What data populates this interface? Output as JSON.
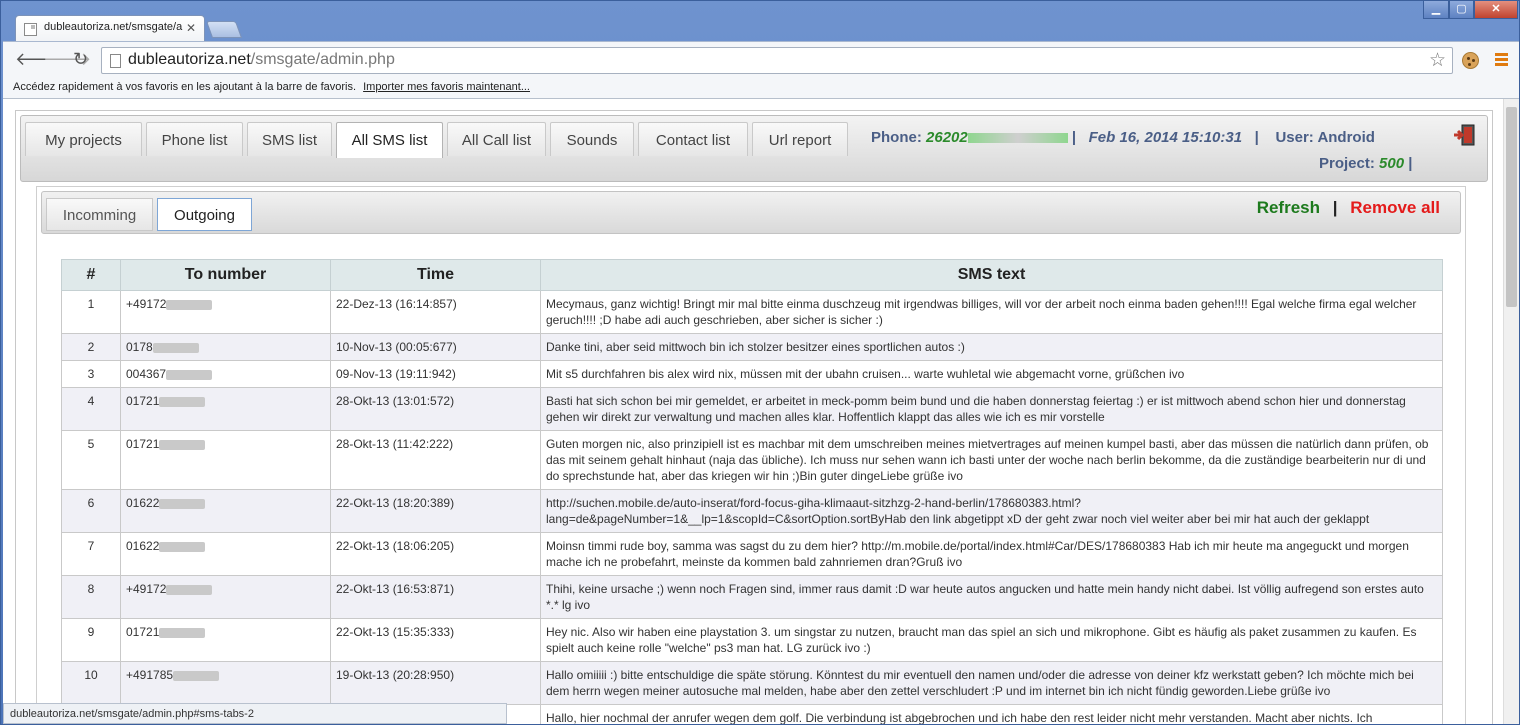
{
  "browser": {
    "tab_title": "dubleautoriza.net/smsgate/a",
    "url_domain": "dubleautoriza.net",
    "url_path": "/smsgate/admin.php",
    "bookmarks_text": "Accédez rapidement à vos favoris en les ajoutant à la barre de favoris.",
    "bookmarks_link": "Importer mes favoris maintenant...",
    "status_url": "dubleautoriza.net/smsgate/admin.php#sms-tabs-2"
  },
  "nav": {
    "tabs": [
      "My projects",
      "Phone list",
      "SMS list",
      "All SMS list",
      "All Call list",
      "Sounds",
      "Contact list",
      "Url report"
    ],
    "active": "All SMS list"
  },
  "header": {
    "phone_label": "Phone:",
    "phone_value": "26202",
    "date": "Feb 16, 2014 15:10:31",
    "user_label": "User:",
    "user_value": "Android",
    "project_label": "Project:",
    "project_value": "500",
    "separator": "|"
  },
  "subnav": {
    "tabs": [
      "Incomming",
      "Outgoing"
    ],
    "active": "Outgoing",
    "refresh": "Refresh",
    "separator": "|",
    "remove_all": "Remove all"
  },
  "table": {
    "headers": [
      "#",
      "To number",
      "Time",
      "SMS text"
    ],
    "rows": [
      {
        "n": "1",
        "to": "+49172",
        "time": "22-Dez-13 (16:14:857)",
        "text": "Mecymaus, ganz wichtig! Bringt mir mal bitte einma duschzeug mit irgendwas billiges, will vor der arbeit noch einma baden gehen!!!! Egal welche firma egal welcher geruch!!!! ;D habe adi auch geschrieben, aber sicher is sicher :)"
      },
      {
        "n": "2",
        "to": "0178",
        "time": "10-Nov-13 (00:05:677)",
        "text": "Danke tini, aber seid mittwoch bin ich stolzer besitzer eines sportlichen autos :)"
      },
      {
        "n": "3",
        "to": "004367",
        "time": "09-Nov-13 (19:11:942)",
        "text": "Mit s5 durchfahren bis alex wird nix, müssen mit der ubahn cruisen... warte wuhletal wie abgemacht vorne, grüßchen ivo"
      },
      {
        "n": "4",
        "to": "01721",
        "time": "28-Okt-13 (13:01:572)",
        "text": "Basti hat sich schon bei mir gemeldet, er arbeitet in meck-pomm beim bund und die haben donnerstag feiertag :) er ist mittwoch abend schon hier und donnerstag gehen wir direkt zur verwaltung und machen alles klar. Hoffentlich klappt das alles wie ich es mir vorstelle"
      },
      {
        "n": "5",
        "to": "01721",
        "time": "28-Okt-13 (11:42:222)",
        "text": "Guten morgen nic, also prinzipiell ist es machbar mit dem umschreiben meines mietvertrages auf meinen kumpel basti, aber das müssen die natürlich dann prüfen, ob das mit seinem gehalt hinhaut (naja das übliche). Ich muss nur sehen wann ich basti unter der woche nach berlin bekomme, da die zuständige bearbeiterin nur di und do sprechstunde hat, aber das kriegen wir hin ;)Bin guter dingeLiebe grüße ivo"
      },
      {
        "n": "6",
        "to": "01622",
        "time": "22-Okt-13 (18:20:389)",
        "text": "http://suchen.mobile.de/auto-inserat/ford-focus-giha-klimaaut-sitzhzg-2-hand-berlin/178680383.html?lang=de&pageNumber=1&__lp=1&scopId=C&sortOption.sortByHab den link abgetippt xD der geht zwar noch viel weiter aber bei mir hat auch der geklappt"
      },
      {
        "n": "7",
        "to": "01622",
        "time": "22-Okt-13 (18:06:205)",
        "text": "Moinsn timmi rude boy, samma was sagst du zu dem hier? http://m.mobile.de/portal/index.html#Car/DES/178680383 Hab ich mir heute ma angeguckt und morgen mache ich ne probefahrt, meinste da kommen bald zahnriemen dran?Gruß ivo"
      },
      {
        "n": "8",
        "to": "+49172",
        "time": "22-Okt-13 (16:53:871)",
        "text": "Thihi, keine ursache ;) wenn noch Fragen sind, immer raus damit :D war heute autos angucken und hatte mein handy nicht dabei. Ist völlig aufregend son erstes auto *.* lg ivo"
      },
      {
        "n": "9",
        "to": "01721",
        "time": "22-Okt-13 (15:35:333)",
        "text": "Hey nic. Also wir haben eine playstation 3. um singstar zu nutzen, braucht man das spiel an sich und mikrophone. Gibt es häufig als paket zusammen zu kaufen. Es spielt auch keine rolle \"welche\" ps3 man hat. LG zurück ivo :)"
      },
      {
        "n": "10",
        "to": "+491785",
        "time": "19-Okt-13 (20:28:950)",
        "text": "Hallo omiiiii :) bitte entschuldige die späte störung. Könntest du mir eventuell den namen und/oder die adresse von deiner kfz werkstatt geben? Ich möchte mich bei dem herrn wegen meiner autosuche mal melden, habe aber den zettel verschludert :P und im internet bin ich nicht fündig geworden.Liebe grüße ivo"
      },
      {
        "n": "",
        "to": "",
        "time": "",
        "text": "Hallo, hier nochmal der anrufer wegen dem golf. Die verbindung ist abgebrochen und ich habe den rest leider nicht mehr verstanden. Macht aber nichts. Ich"
      }
    ]
  },
  "colors": {
    "refresh": "#1d7a1d",
    "remove": "#e41b1b",
    "phone_number": "#2b8a2b",
    "header_text": "#4a5e86"
  }
}
